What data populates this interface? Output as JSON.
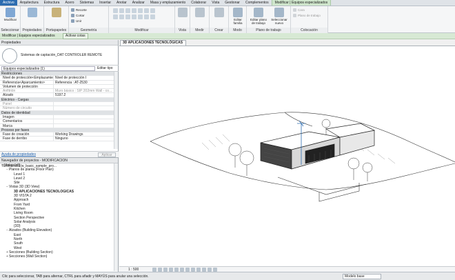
{
  "tabs": [
    "Archivo",
    "Arquitectura",
    "Estructura",
    "Acero",
    "Sistemas",
    "Insertar",
    "Anotar",
    "Analizar",
    "Masa y emplazamiento",
    "Colaborar",
    "Vista",
    "Gestionar",
    "Complementos",
    "Modificar | Equipos especializados"
  ],
  "ribbon": {
    "modificar_btn": "Modificar",
    "seleccionar": "Seleccionar",
    "propiedades": "Propiedades",
    "portapapeles": "Portapapeles",
    "geometria": "Geometría",
    "recortar": "Recorte",
    "cortar": "Cortar",
    "unir": "Unir",
    "modificar": "Modificar",
    "vista": "Vista",
    "medir": "Medir",
    "crear": "Crear",
    "modo": "Modo",
    "editar_familia": "Editar familia",
    "plano_trabajo": "Plano de trabajo",
    "editar_plano": "Editar plano de trabajo",
    "seleccionar_nuevo": "Seleccionar nuevo",
    "colocacion": "Colocación",
    "cara": "Cara",
    "plano_de_trabajo_opt": "Plano de trabajo"
  },
  "context_bar": {
    "label": "Modificar | Equipos especializados",
    "activar": "Activar cotas"
  },
  "properties": {
    "title": "Propiedades",
    "type_name": "Sistemas de captación_DAT CONTROLER REMOTE",
    "filter": "Equipos especializados (1)",
    "edit_type": "Editar tipo",
    "rows": [
      {
        "k": "Restricciones",
        "v": "",
        "sec": true
      },
      {
        "k": "Nivel de protección<Emplazamien...",
        "v": "Nivel de protección I"
      },
      {
        "k": "Referencia<Aparcamiento>",
        "v": "Referencia : AT-2530"
      },
      {
        "k": "Volumen de protección",
        "v": ""
      },
      {
        "k": "Anfitrión",
        "v": "Muro básico : SIP 202mm Wall - co...",
        "dim": true
      },
      {
        "k": "Alzado",
        "v": "5197.2"
      },
      {
        "k": "Eléctrico - Cargas",
        "v": "",
        "sec": true
      },
      {
        "k": "Panel",
        "v": "",
        "dim": true
      },
      {
        "k": "Número de circuito",
        "v": "",
        "dim": true
      },
      {
        "k": "Datos de identidad",
        "v": "",
        "sec": true
      },
      {
        "k": "Imagen",
        "v": ""
      },
      {
        "k": "Comentarios",
        "v": ""
      },
      {
        "k": "Marca",
        "v": ""
      },
      {
        "k": "Proceso por fases",
        "v": "",
        "sec": true
      },
      {
        "k": "Fase de creación",
        "v": "Working Drawings"
      },
      {
        "k": "Fase de derribo",
        "v": "Ninguno"
      }
    ],
    "help": "Ayuda de propiedades",
    "apply": "Aplicar"
  },
  "browser": {
    "title": "Navegador de proyectos - MODIFICACION TERRENO2(w_basic_sample_pro...",
    "items": [
      {
        "t": "Vistas (all)",
        "lvl": 0,
        "tog": "−"
      },
      {
        "t": "Planos de planta (Floor Plan)",
        "lvl": 1,
        "tog": "−"
      },
      {
        "t": "Level 1",
        "lvl": 2
      },
      {
        "t": "Level 2",
        "lvl": 2
      },
      {
        "t": "Site",
        "lvl": 2
      },
      {
        "t": "Vistas 3D (3D View)",
        "lvl": 1,
        "tog": "−"
      },
      {
        "t": "3D APLICACIONES TECNOLÓGICAS",
        "lvl": 2,
        "bold": true
      },
      {
        "t": "3D VISTA 2",
        "lvl": 2
      },
      {
        "t": "Approach",
        "lvl": 2
      },
      {
        "t": "From Yard",
        "lvl": 2
      },
      {
        "t": "Kitchen",
        "lvl": 2
      },
      {
        "t": "Living Room",
        "lvl": 2
      },
      {
        "t": "Section Perspective",
        "lvl": 2
      },
      {
        "t": "Solar Analysis",
        "lvl": 2
      },
      {
        "t": "{3D}",
        "lvl": 2
      },
      {
        "t": "Alzados (Building Elevation)",
        "lvl": 1,
        "tog": "−"
      },
      {
        "t": "East",
        "lvl": 2
      },
      {
        "t": "North",
        "lvl": 2
      },
      {
        "t": "South",
        "lvl": 2
      },
      {
        "t": "West",
        "lvl": 2
      },
      {
        "t": "Secciones (Building Section)",
        "lvl": 1,
        "tog": "+"
      },
      {
        "t": "Secciones (Wall Section)",
        "lvl": 1,
        "tog": "+"
      }
    ]
  },
  "viewport": {
    "tab_title": "3D APLICACIONES TECNOLÓGICAS",
    "scale": "1 : 500"
  },
  "status": {
    "text": "Clic para seleccionar, TAB para alternar, CTRL para añadir y MAYÚS para anular una selección.",
    "model": "Modelo base"
  },
  "colors": {
    "accent": "#2c6cb0",
    "context": "#d7e9d4"
  }
}
